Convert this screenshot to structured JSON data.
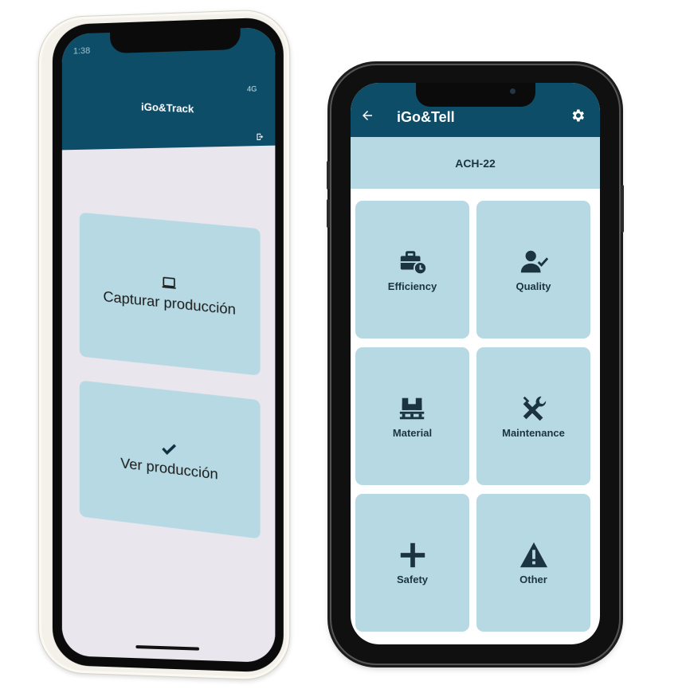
{
  "left_app": {
    "status_time": "1:38",
    "status_right": "4G",
    "title": "iGo&Track",
    "actions": [
      {
        "label": "Capturar producción",
        "icon": "laptop-icon"
      },
      {
        "label": "Ver producción",
        "icon": "checkmark-icon"
      }
    ],
    "exit_icon": "logout-icon"
  },
  "right_app": {
    "title": "iGo&Tell",
    "subtitle": "ACH-22",
    "tiles": [
      {
        "label": "Efficiency",
        "icon": "briefcase-clock-icon"
      },
      {
        "label": "Quality",
        "icon": "user-check-icon"
      },
      {
        "label": "Material",
        "icon": "pallet-boxes-icon"
      },
      {
        "label": "Maintenance",
        "icon": "tools-icon"
      },
      {
        "label": "Safety",
        "icon": "plus-icon"
      },
      {
        "label": "Other",
        "icon": "warning-icon"
      }
    ]
  },
  "colors": {
    "header": "#0d4d68",
    "tile": "#b6d9e3",
    "tile_text": "#1c3440",
    "left_background": "#e9e6ee"
  }
}
